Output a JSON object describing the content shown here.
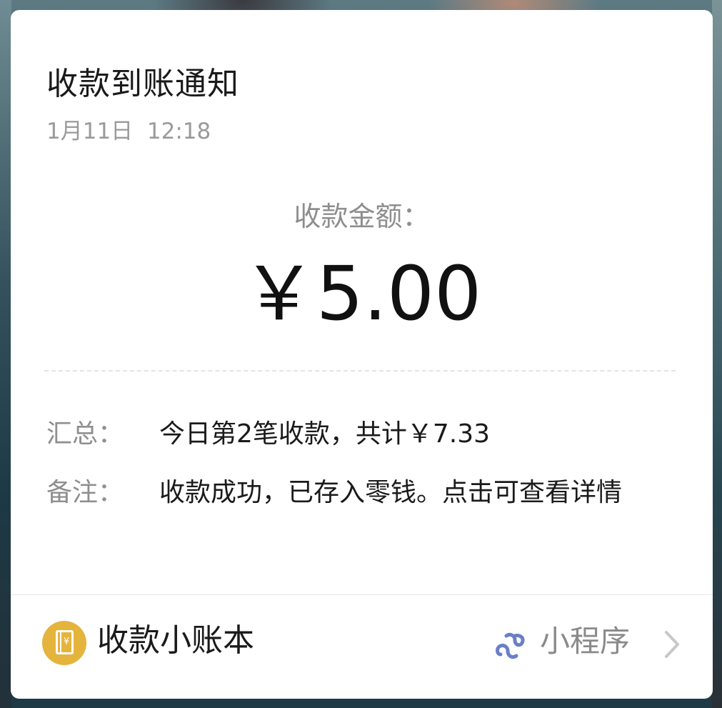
{
  "notification": {
    "title": "收款到账通知",
    "time": "1月11日  12:18",
    "amount_label": "收款金额：",
    "amount_value": "￥5.00",
    "summary_label": "汇总：",
    "summary_value": "今日第2笔收款，共计￥7.33",
    "note_label": "备注：",
    "note_value": "收款成功，已存入零钱。点击可查看详情"
  },
  "footer": {
    "app_icon": "ledger-book-icon",
    "app_icon_glyph": "¥",
    "app_name": "收款小账本",
    "mini_program_icon": "mini-program-icon",
    "mini_program_label": "小程序",
    "chevron_icon": "chevron-right-icon"
  },
  "colors": {
    "card_background": "#ffffff",
    "app_icon_background": "#e5b43d",
    "mini_program_icon": "#6b7fc8",
    "secondary_text": "#8f8f8f",
    "primary_text": "#1a1a1a"
  }
}
